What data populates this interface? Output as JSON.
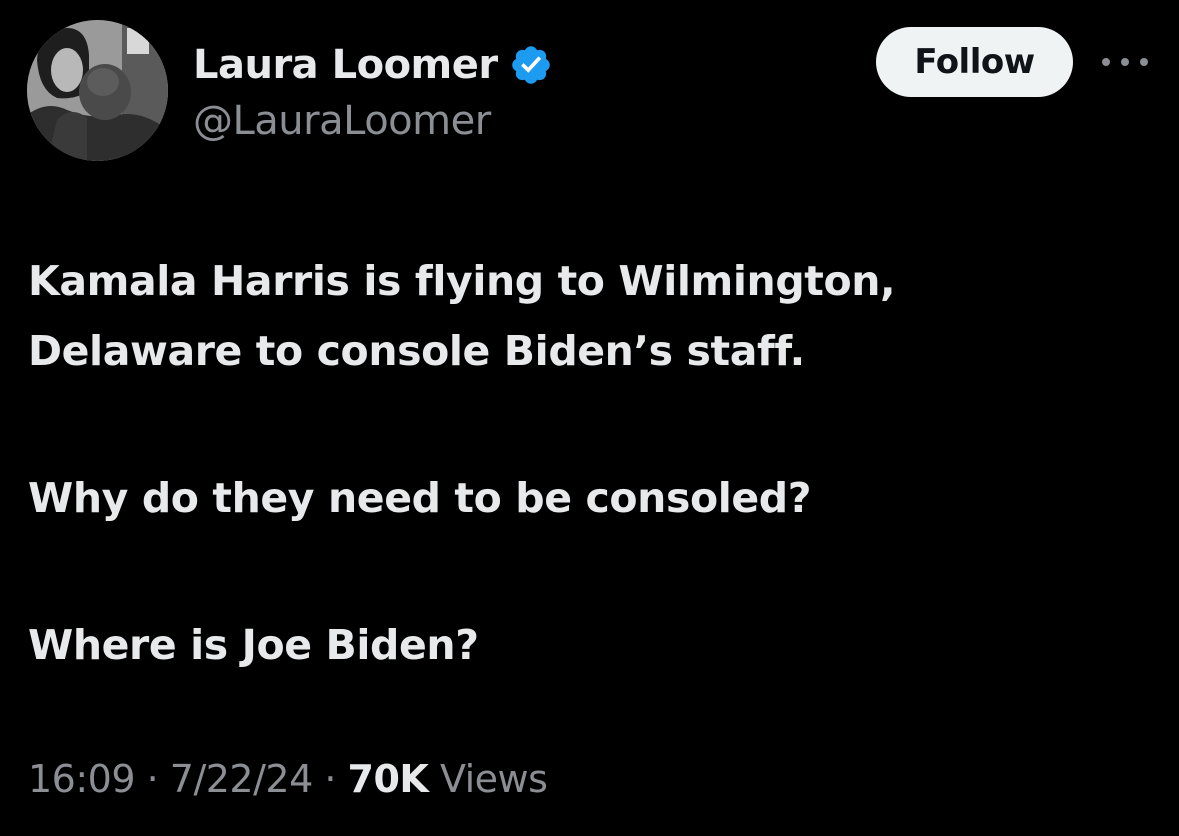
{
  "author": {
    "display_name": "Laura Loomer",
    "handle": "@LauraLoomer",
    "verified": true,
    "verified_color": "#1d9bf0",
    "avatar_icon": "profile-photo"
  },
  "actions": {
    "follow_label": "Follow",
    "more_icon": "more-horizontal-icon"
  },
  "tweet": {
    "paragraphs": [
      [
        "Kamala Harris is flying to Wilmington,",
        "Delaware to console Biden’s staff."
      ],
      [
        "Why do they need to be consoled?"
      ],
      [
        "Where is Joe Biden?"
      ]
    ]
  },
  "meta": {
    "time": "16:09",
    "date": "7/22/24",
    "separator": " · ",
    "views_count": "70K",
    "views_label": "Views"
  },
  "colors": {
    "background": "#000000",
    "primary_text": "#e7e9ea",
    "secondary_text": "#8b8f94",
    "button_bg": "#eff3f4"
  }
}
